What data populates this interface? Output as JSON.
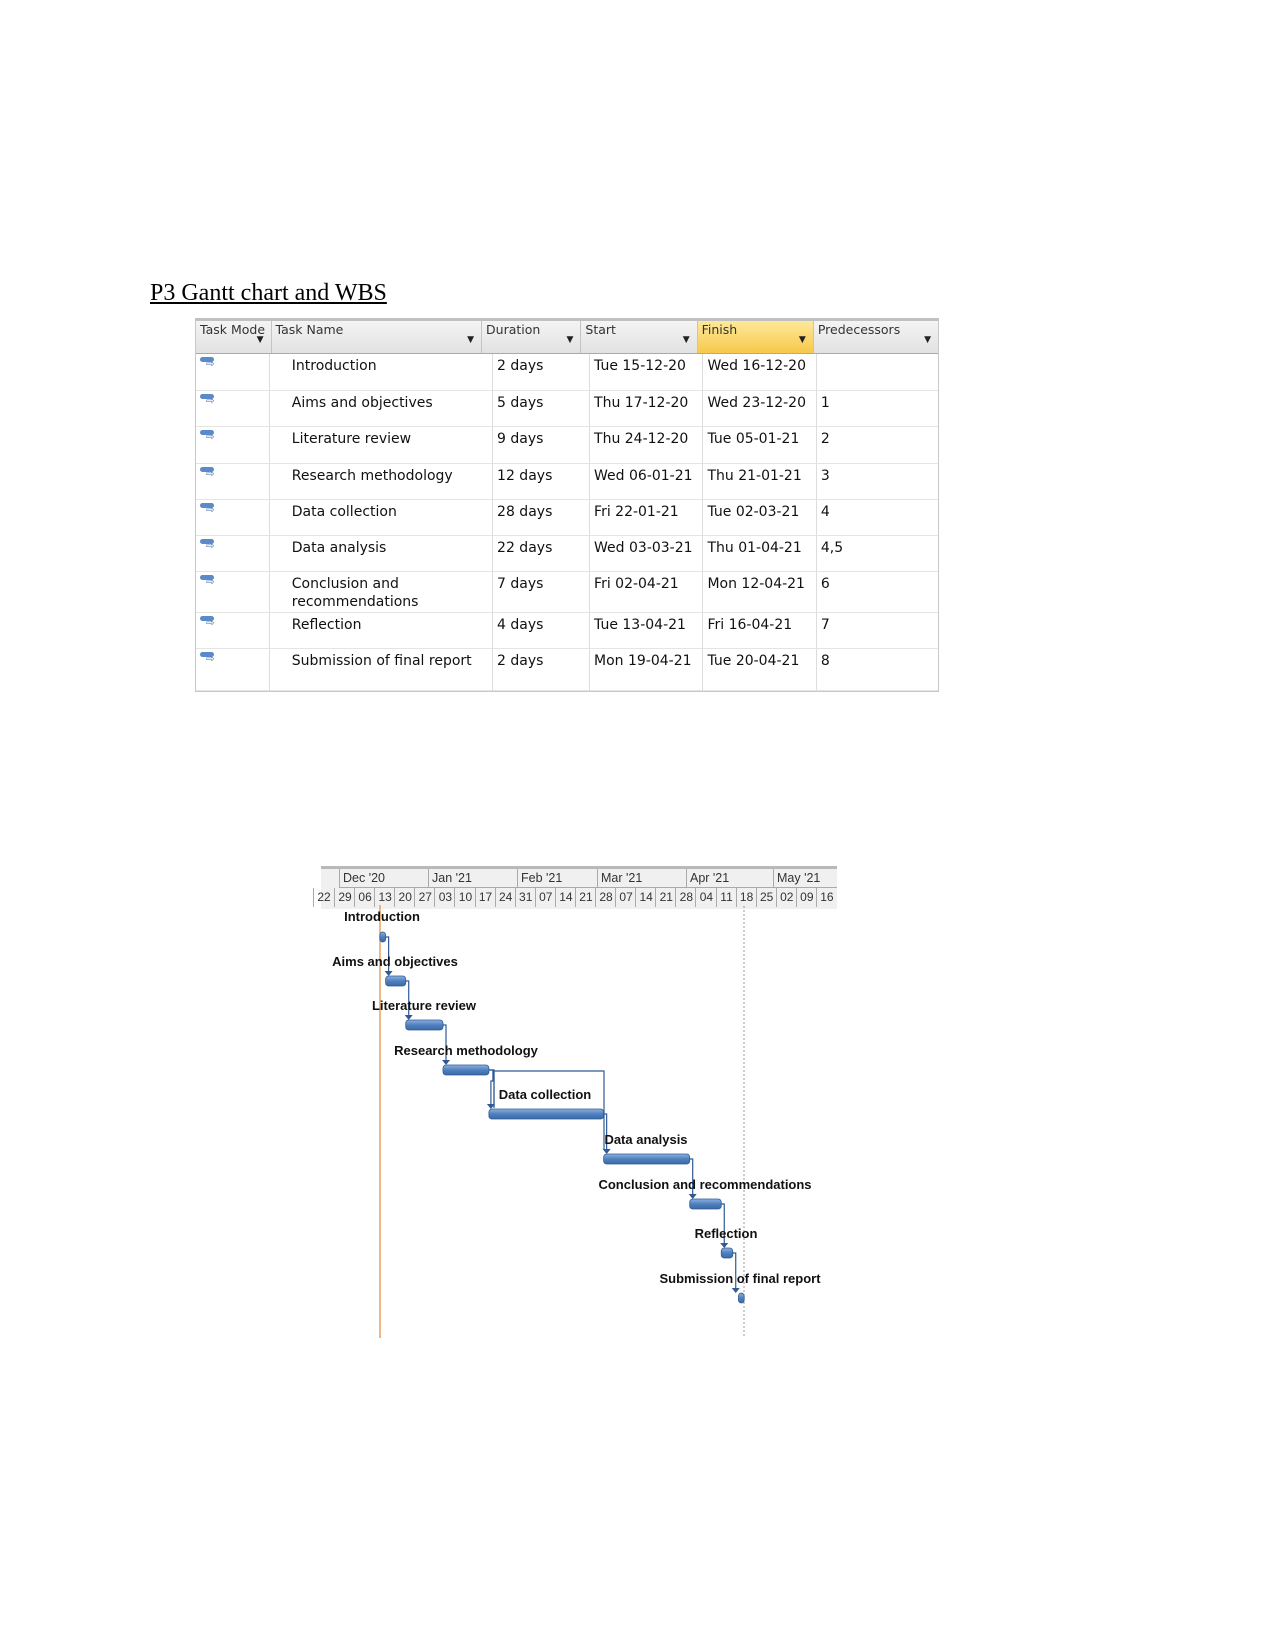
{
  "title": "P3 Gantt chart and WBS ",
  "table": {
    "headers": [
      "Task Mode",
      "Task Name",
      "Duration",
      "Start",
      "Finish",
      "Predecessors"
    ],
    "rows": [
      {
        "name": "Introduction",
        "duration": "2 days",
        "start": "Tue 15-12-20",
        "finish": "Wed 16-12-20",
        "pred": ""
      },
      {
        "name": "Aims and objectives",
        "duration": "5 days",
        "start": "Thu 17-12-20",
        "finish": "Wed 23-12-20",
        "pred": "1"
      },
      {
        "name": "Literature review",
        "duration": "9 days",
        "start": "Thu 24-12-20",
        "finish": "Tue 05-01-21",
        "pred": "2"
      },
      {
        "name": "Research methodology",
        "duration": "12 days",
        "start": "Wed 06-01-21",
        "finish": "Thu 21-01-21",
        "pred": "3"
      },
      {
        "name": "Data collection",
        "duration": "28 days",
        "start": "Fri 22-01-21",
        "finish": "Tue 02-03-21",
        "pred": "4"
      },
      {
        "name": "Data analysis",
        "duration": "22 days",
        "start": "Wed 03-03-21",
        "finish": "Thu 01-04-21",
        "pred": "4,5"
      },
      {
        "name": "Conclusion and recommendations",
        "duration": "7 days",
        "start": "Fri 02-04-21",
        "finish": "Mon 12-04-21",
        "pred": "6"
      },
      {
        "name": "Reflection",
        "duration": "4 days",
        "start": "Tue 13-04-21",
        "finish": "Fri 16-04-21",
        "pred": "7"
      },
      {
        "name": "Submission of final report",
        "duration": "2 days",
        "start": "Mon 19-04-21",
        "finish": "Tue 20-04-21",
        "pred": "8"
      }
    ],
    "header_highlight_color": "#f7c94a",
    "task_mode_icon": "auto-scheduled-task-icon"
  },
  "chart_data": {
    "type": "gantt",
    "months": [
      "Dec '20",
      "Jan '21",
      "Feb '21",
      "Mar '21",
      "Apr '21",
      "May '21"
    ],
    "weeks": [
      "22",
      "29",
      "06",
      "13",
      "20",
      "27",
      "03",
      "10",
      "17",
      "24",
      "31",
      "07",
      "14",
      "21",
      "28",
      "07",
      "14",
      "21",
      "28",
      "04",
      "11",
      "18",
      "25",
      "02",
      "09",
      "16"
    ],
    "tasks": [
      {
        "name": "Introduction",
        "start": "2020-12-15",
        "finish": "2020-12-16"
      },
      {
        "name": "Aims and objectives",
        "start": "2020-12-17",
        "finish": "2020-12-23"
      },
      {
        "name": "Literature review",
        "start": "2020-12-24",
        "finish": "2021-01-05"
      },
      {
        "name": "Research methodology",
        "start": "2021-01-06",
        "finish": "2021-01-21"
      },
      {
        "name": "Data collection",
        "start": "2021-01-22",
        "finish": "2021-03-02"
      },
      {
        "name": "Data analysis",
        "start": "2021-03-03",
        "finish": "2021-04-01"
      },
      {
        "name": "Conclusion and recommendations",
        "start": "2021-04-02",
        "finish": "2021-04-12"
      },
      {
        "name": "Reflection",
        "start": "2021-04-13",
        "finish": "2021-04-16"
      },
      {
        "name": "Submission of final report",
        "start": "2021-04-19",
        "finish": "2021-04-20"
      }
    ],
    "bar_color": "#4f81bd",
    "today_line_color": "#e8a060"
  }
}
